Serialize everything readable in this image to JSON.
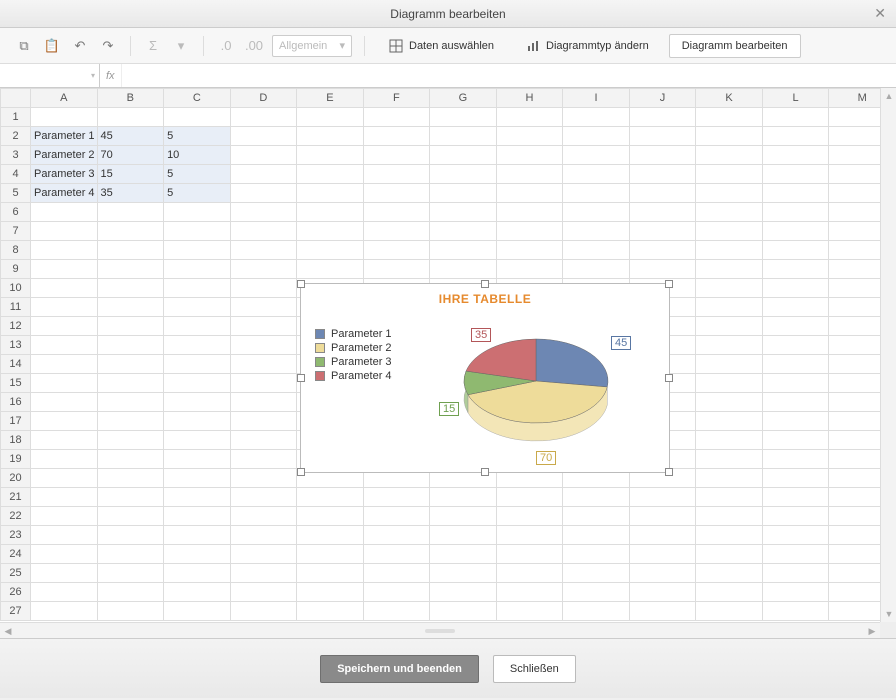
{
  "window": {
    "title": "Diagramm bearbeiten"
  },
  "toolbar": {
    "format": "Allgemein",
    "select_data": "Daten auswählen",
    "change_type": "Diagrammtyp ändern",
    "edit_chart": "Diagramm bearbeiten"
  },
  "cell_ref": "",
  "columns": [
    "A",
    "B",
    "C",
    "D",
    "E",
    "F",
    "G",
    "H",
    "I",
    "J",
    "K",
    "L",
    "M"
  ],
  "rows": 27,
  "cells": {
    "A2": "Parameter 1",
    "B2": "45",
    "C2": "5",
    "A3": "Parameter 2",
    "B3": "70",
    "C3": "10",
    "A4": "Parameter 3",
    "B4": "15",
    "C4": "5",
    "A5": "Parameter 4",
    "B5": "35",
    "C5": "5"
  },
  "footer": {
    "save": "Speichern und beenden",
    "close": "Schließen"
  },
  "chart_data": {
    "type": "pie",
    "title": "IHRE TABELLE",
    "categories": [
      "Parameter 1",
      "Parameter 2",
      "Parameter 3",
      "Parameter 4"
    ],
    "values": [
      45,
      70,
      15,
      35
    ],
    "colors": [
      "#6d87b3",
      "#eedc9a",
      "#8fb970",
      "#cc6f72"
    ],
    "data_labels": true,
    "legend_position": "left",
    "style": "3d"
  }
}
